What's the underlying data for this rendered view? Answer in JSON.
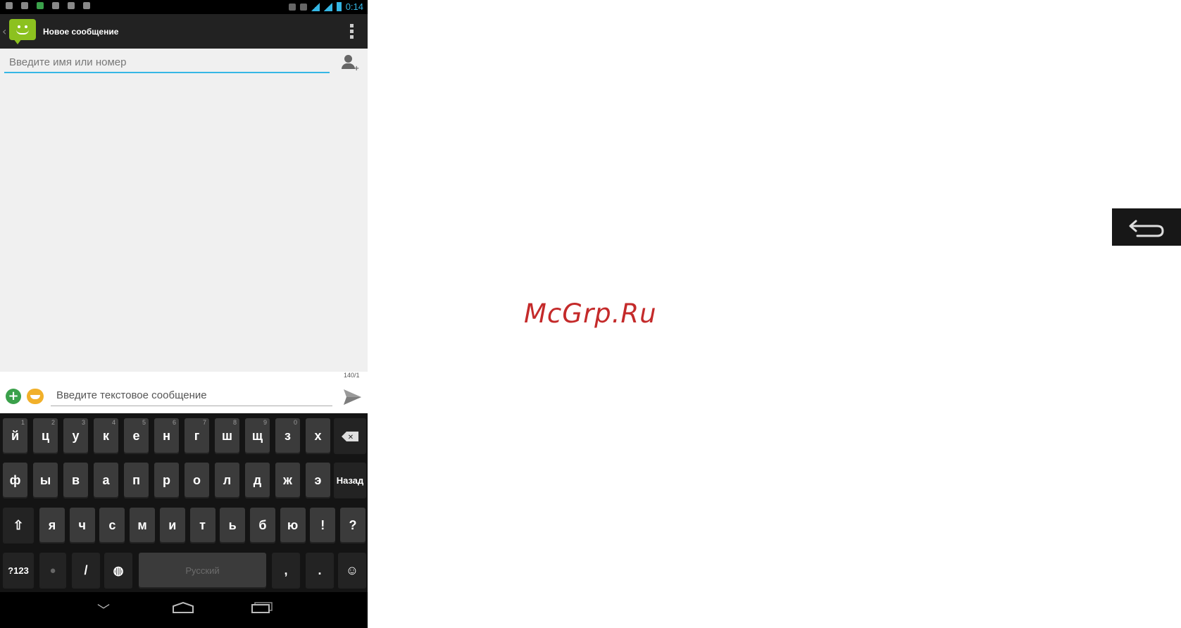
{
  "status_bar": {
    "time": "0:14"
  },
  "action_bar": {
    "title": "Новое сообщение"
  },
  "recipient": {
    "placeholder": "Введите имя или номер"
  },
  "compose": {
    "counter": "140/1",
    "placeholder": "Введите текстовое сообщение"
  },
  "keyboard": {
    "row1": [
      {
        "label": "й",
        "hint": "1"
      },
      {
        "label": "ц",
        "hint": "2"
      },
      {
        "label": "у",
        "hint": "3"
      },
      {
        "label": "к",
        "hint": "4"
      },
      {
        "label": "е",
        "hint": "5"
      },
      {
        "label": "н",
        "hint": "6"
      },
      {
        "label": "г",
        "hint": "7"
      },
      {
        "label": "ш",
        "hint": "8"
      },
      {
        "label": "щ",
        "hint": "9"
      },
      {
        "label": "з",
        "hint": "0"
      },
      {
        "label": "х",
        "hint": ""
      }
    ],
    "row2": [
      "ф",
      "ы",
      "в",
      "а",
      "п",
      "р",
      "о",
      "л",
      "д",
      "ж",
      "э"
    ],
    "enter_label": "Назад",
    "row3": [
      "я",
      "ч",
      "с",
      "м",
      "и",
      "т",
      "ь",
      "б",
      "ю",
      "!",
      "?"
    ],
    "symbols_label": "?123",
    "slash_label": "/",
    "space_label": "Русский",
    "comma_label": ",",
    "period_label": "."
  },
  "watermark": "McGrp.Ru",
  "colors": {
    "accent": "#35b7e5",
    "watermark": "#c42a2a",
    "app_icon": "#8cc11f"
  }
}
